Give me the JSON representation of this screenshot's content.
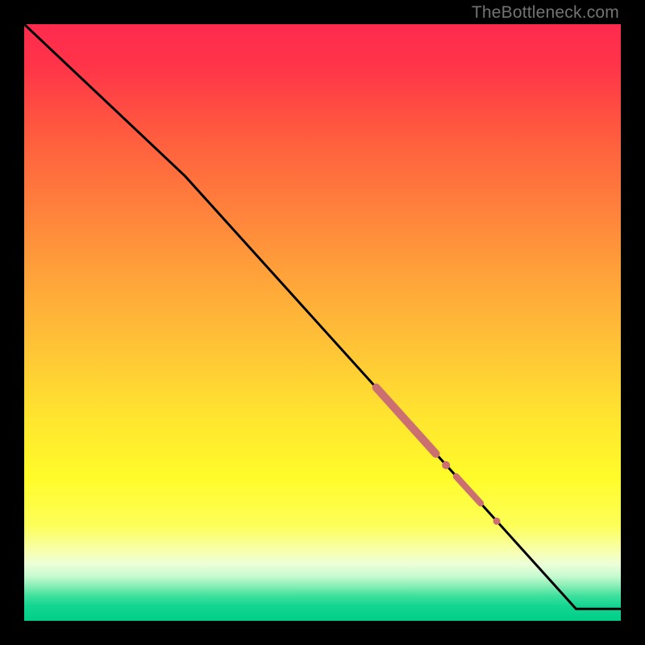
{
  "watermark": {
    "text": "TheBottleneck.com"
  },
  "colors": {
    "background": "#000000",
    "curve_stroke": "#000000",
    "marker_fill": "#cc6f70",
    "gradient_stops": [
      {
        "offset": 0.0,
        "color": "#ff2b4e"
      },
      {
        "offset": 0.07,
        "color": "#ff3449"
      },
      {
        "offset": 0.18,
        "color": "#ff5a3f"
      },
      {
        "offset": 0.3,
        "color": "#ff7e3c"
      },
      {
        "offset": 0.42,
        "color": "#ffa23a"
      },
      {
        "offset": 0.55,
        "color": "#ffc636"
      },
      {
        "offset": 0.66,
        "color": "#ffe52f"
      },
      {
        "offset": 0.76,
        "color": "#fffb2a"
      },
      {
        "offset": 0.84,
        "color": "#fdff58"
      },
      {
        "offset": 0.885,
        "color": "#f7ffb2"
      },
      {
        "offset": 0.905,
        "color": "#ecffd8"
      },
      {
        "offset": 0.925,
        "color": "#c7fad0"
      },
      {
        "offset": 0.942,
        "color": "#86edb5"
      },
      {
        "offset": 0.958,
        "color": "#3fe09e"
      },
      {
        "offset": 0.975,
        "color": "#13d590"
      },
      {
        "offset": 1.0,
        "color": "#00cf8a"
      }
    ]
  },
  "chart_data": {
    "type": "line",
    "title": "",
    "xlabel": "",
    "ylabel": "",
    "xlim": [
      0,
      100
    ],
    "ylim": [
      0,
      100
    ],
    "series": [
      {
        "name": "curve",
        "x": [
          0.0,
          27.0,
          92.5,
          100.0
        ],
        "y": [
          100.0,
          74.5,
          2.0,
          2.0
        ]
      }
    ],
    "markers": [
      {
        "name": "thick-segment-1",
        "type": "segment",
        "x": [
          59.0,
          69.0
        ],
        "y": [
          39.1,
          28.0
        ],
        "width": 10
      },
      {
        "name": "dot-1",
        "type": "dot",
        "x": 70.7,
        "y": 26.1,
        "r": 5
      },
      {
        "name": "thick-segment-2",
        "type": "segment",
        "x": [
          72.4,
          76.5
        ],
        "y": [
          24.2,
          19.7
        ],
        "width": 8
      },
      {
        "name": "dot-2",
        "type": "dot",
        "x": 79.2,
        "y": 16.7,
        "r": 4.5
      }
    ]
  }
}
